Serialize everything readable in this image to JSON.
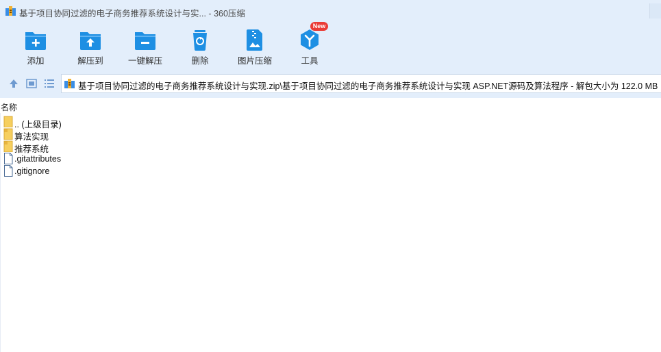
{
  "window": {
    "title": "基于项目协同过滤的电子商务推荐系统设计与实...",
    "separator": "-",
    "app_name": "360压缩"
  },
  "toolbar": {
    "items": [
      {
        "label": "添加",
        "icon": "add-folder-icon"
      },
      {
        "label": "解压到",
        "icon": "extract-to-icon"
      },
      {
        "label": "一键解压",
        "icon": "one-click-extract-icon"
      },
      {
        "label": "删除",
        "icon": "trash-icon"
      },
      {
        "label": "图片压缩",
        "icon": "image-compress-icon"
      },
      {
        "label": "工具",
        "icon": "tools-icon"
      }
    ],
    "new_badge": "New"
  },
  "nav": {
    "path": "基于项目协同过滤的电子商务推荐系统设计与实现.zip\\基于项目协同过滤的电子商务推荐系统设计与实现 ASP.NET源码及算法程序 - 解包大小为 122.0 MB"
  },
  "list": {
    "column_name": "名称",
    "rows": [
      {
        "name": ".. (上级目录)",
        "type": "folder"
      },
      {
        "name": "算法实现",
        "type": "folder"
      },
      {
        "name": "推荐系统",
        "type": "folder"
      },
      {
        "name": ".gitattributes",
        "type": "file"
      },
      {
        "name": ".gitignore",
        "type": "file"
      }
    ]
  },
  "colors": {
    "chrome_bg": "#e3eefb",
    "icon_blue": "#1e8fe3",
    "badge_red": "#ea3b36",
    "folder_yellow": "#f6cf5f"
  }
}
